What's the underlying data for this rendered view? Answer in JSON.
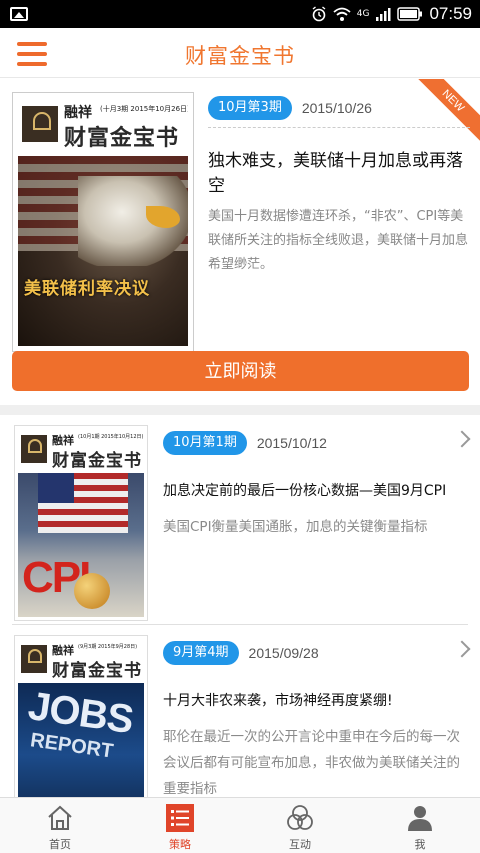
{
  "status_bar": {
    "time": "07:59",
    "network": "4G",
    "icons": [
      "image-icon",
      "alarm-icon",
      "wifi-icon",
      "signal-icon",
      "battery-icon"
    ]
  },
  "header": {
    "title": "财富金宝书",
    "menu_icon": "hamburger-icon"
  },
  "featured": {
    "ribbon": "NEW",
    "issue_badge": "10月第3期",
    "date": "2015/10/26",
    "title": "独木难支，美联储十月加息或再落空",
    "description": "美国十月数据惨遭连环杀，“非农”、CPI等美联储所关注的指标全线败退，美联储十月加息希望缈茫。",
    "read_button": "立即阅读",
    "cover": {
      "brand": "融祥",
      "issue": "(十月3期 2015年10月26日)",
      "name": "财富金宝书",
      "headline": "美联储利率决议"
    }
  },
  "list": [
    {
      "issue_badge": "10月第1期",
      "date": "2015/10/12",
      "title": "加息决定前的最后一份核心数据—美国9月CPI",
      "description": "美国CPI衡量美国通胀，加息的关键衡量指标",
      "cover": {
        "brand": "融祥",
        "issue": "(10月1期 2015年10月12日)",
        "name": "财富金宝书",
        "art_text": "CPI"
      }
    },
    {
      "issue_badge": "9月第4期",
      "date": "2015/09/28",
      "title": "十月大非农来袭，市场神经再度紧绷!",
      "description": "耶伦在最近一次的公开言论中重申在今后的每一次会议后都有可能宣布加息，非农做为美联储关注的重要指标",
      "cover": {
        "brand": "融祥",
        "issue": "(9月3期 2015年9月28日)",
        "name": "财富金宝书",
        "art_text": "JOBS",
        "art_text2": "REPORT"
      }
    }
  ],
  "bottom_nav": [
    {
      "label": "首页",
      "icon": "home-icon",
      "active": false
    },
    {
      "label": "策略",
      "icon": "list-icon",
      "active": true
    },
    {
      "label": "互动",
      "icon": "circles-icon",
      "active": false
    },
    {
      "label": "我",
      "icon": "user-icon",
      "active": false
    }
  ],
  "colors": {
    "accent": "#ef6f2c",
    "badge": "#2196e8",
    "active_tab": "#e0452a"
  }
}
